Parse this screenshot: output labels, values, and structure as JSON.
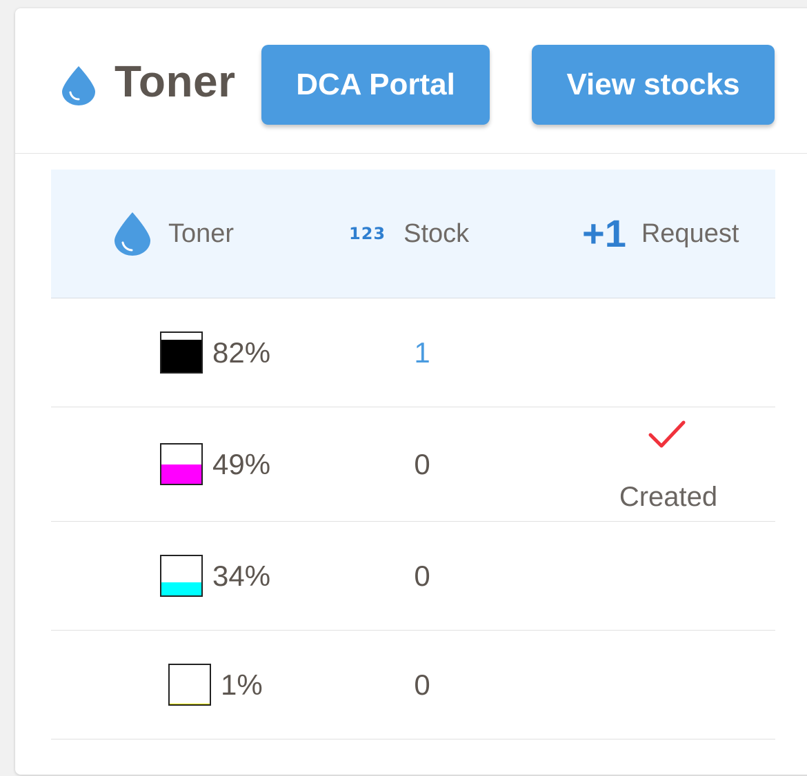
{
  "header": {
    "title": "Toner",
    "buttons": {
      "dca_portal": "DCA Portal",
      "view_stocks": "View stocks"
    }
  },
  "table": {
    "columns": {
      "toner": "Toner",
      "stock": "Stock",
      "stock_icon_text": "123",
      "request": "Request",
      "request_icon_text": "+1"
    },
    "rows": [
      {
        "color": "#000000",
        "level_percent": 82,
        "level_label": "82%",
        "stock": "1",
        "request_status": ""
      },
      {
        "color": "#ff00ff",
        "level_percent": 49,
        "level_label": "49%",
        "stock": "0",
        "request_status": "Created"
      },
      {
        "color": "#00ffff",
        "level_percent": 34,
        "level_label": "34%",
        "stock": "0",
        "request_status": ""
      },
      {
        "color": "#ffff00",
        "level_percent": 1,
        "level_label": "1%",
        "stock": "0",
        "request_status": ""
      }
    ]
  },
  "colors": {
    "accent": "#4a9be0",
    "check": "#f0323c",
    "text": "#5d5650"
  }
}
